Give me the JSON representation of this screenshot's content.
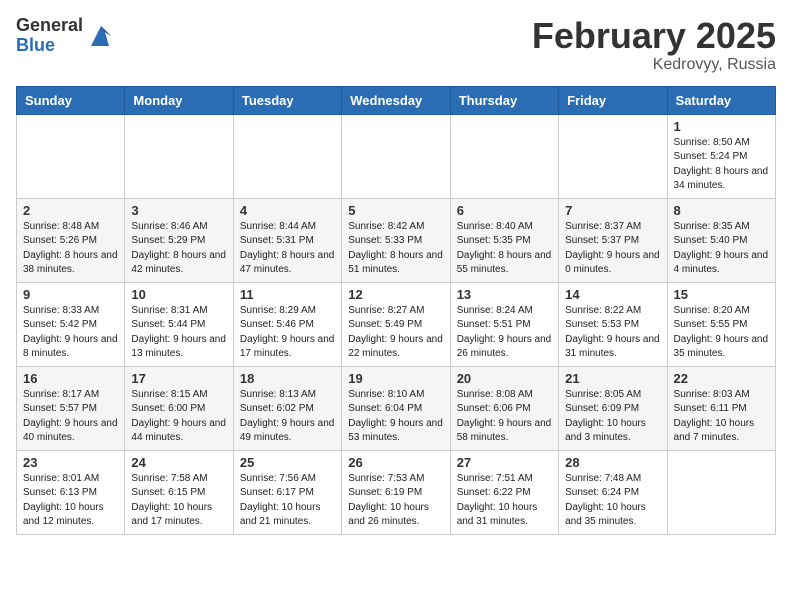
{
  "header": {
    "logo_general": "General",
    "logo_blue": "Blue",
    "month_year": "February 2025",
    "location": "Kedrovyy, Russia"
  },
  "weekdays": [
    "Sunday",
    "Monday",
    "Tuesday",
    "Wednesday",
    "Thursday",
    "Friday",
    "Saturday"
  ],
  "weeks": [
    [
      {
        "day": "",
        "info": ""
      },
      {
        "day": "",
        "info": ""
      },
      {
        "day": "",
        "info": ""
      },
      {
        "day": "",
        "info": ""
      },
      {
        "day": "",
        "info": ""
      },
      {
        "day": "",
        "info": ""
      },
      {
        "day": "1",
        "info": "Sunrise: 8:50 AM\nSunset: 5:24 PM\nDaylight: 8 hours and 34 minutes."
      }
    ],
    [
      {
        "day": "2",
        "info": "Sunrise: 8:48 AM\nSunset: 5:26 PM\nDaylight: 8 hours and 38 minutes."
      },
      {
        "day": "3",
        "info": "Sunrise: 8:46 AM\nSunset: 5:29 PM\nDaylight: 8 hours and 42 minutes."
      },
      {
        "day": "4",
        "info": "Sunrise: 8:44 AM\nSunset: 5:31 PM\nDaylight: 8 hours and 47 minutes."
      },
      {
        "day": "5",
        "info": "Sunrise: 8:42 AM\nSunset: 5:33 PM\nDaylight: 8 hours and 51 minutes."
      },
      {
        "day": "6",
        "info": "Sunrise: 8:40 AM\nSunset: 5:35 PM\nDaylight: 8 hours and 55 minutes."
      },
      {
        "day": "7",
        "info": "Sunrise: 8:37 AM\nSunset: 5:37 PM\nDaylight: 9 hours and 0 minutes."
      },
      {
        "day": "8",
        "info": "Sunrise: 8:35 AM\nSunset: 5:40 PM\nDaylight: 9 hours and 4 minutes."
      }
    ],
    [
      {
        "day": "9",
        "info": "Sunrise: 8:33 AM\nSunset: 5:42 PM\nDaylight: 9 hours and 8 minutes."
      },
      {
        "day": "10",
        "info": "Sunrise: 8:31 AM\nSunset: 5:44 PM\nDaylight: 9 hours and 13 minutes."
      },
      {
        "day": "11",
        "info": "Sunrise: 8:29 AM\nSunset: 5:46 PM\nDaylight: 9 hours and 17 minutes."
      },
      {
        "day": "12",
        "info": "Sunrise: 8:27 AM\nSunset: 5:49 PM\nDaylight: 9 hours and 22 minutes."
      },
      {
        "day": "13",
        "info": "Sunrise: 8:24 AM\nSunset: 5:51 PM\nDaylight: 9 hours and 26 minutes."
      },
      {
        "day": "14",
        "info": "Sunrise: 8:22 AM\nSunset: 5:53 PM\nDaylight: 9 hours and 31 minutes."
      },
      {
        "day": "15",
        "info": "Sunrise: 8:20 AM\nSunset: 5:55 PM\nDaylight: 9 hours and 35 minutes."
      }
    ],
    [
      {
        "day": "16",
        "info": "Sunrise: 8:17 AM\nSunset: 5:57 PM\nDaylight: 9 hours and 40 minutes."
      },
      {
        "day": "17",
        "info": "Sunrise: 8:15 AM\nSunset: 6:00 PM\nDaylight: 9 hours and 44 minutes."
      },
      {
        "day": "18",
        "info": "Sunrise: 8:13 AM\nSunset: 6:02 PM\nDaylight: 9 hours and 49 minutes."
      },
      {
        "day": "19",
        "info": "Sunrise: 8:10 AM\nSunset: 6:04 PM\nDaylight: 9 hours and 53 minutes."
      },
      {
        "day": "20",
        "info": "Sunrise: 8:08 AM\nSunset: 6:06 PM\nDaylight: 9 hours and 58 minutes."
      },
      {
        "day": "21",
        "info": "Sunrise: 8:05 AM\nSunset: 6:09 PM\nDaylight: 10 hours and 3 minutes."
      },
      {
        "day": "22",
        "info": "Sunrise: 8:03 AM\nSunset: 6:11 PM\nDaylight: 10 hours and 7 minutes."
      }
    ],
    [
      {
        "day": "23",
        "info": "Sunrise: 8:01 AM\nSunset: 6:13 PM\nDaylight: 10 hours and 12 minutes."
      },
      {
        "day": "24",
        "info": "Sunrise: 7:58 AM\nSunset: 6:15 PM\nDaylight: 10 hours and 17 minutes."
      },
      {
        "day": "25",
        "info": "Sunrise: 7:56 AM\nSunset: 6:17 PM\nDaylight: 10 hours and 21 minutes."
      },
      {
        "day": "26",
        "info": "Sunrise: 7:53 AM\nSunset: 6:19 PM\nDaylight: 10 hours and 26 minutes."
      },
      {
        "day": "27",
        "info": "Sunrise: 7:51 AM\nSunset: 6:22 PM\nDaylight: 10 hours and 31 minutes."
      },
      {
        "day": "28",
        "info": "Sunrise: 7:48 AM\nSunset: 6:24 PM\nDaylight: 10 hours and 35 minutes."
      },
      {
        "day": "",
        "info": ""
      }
    ]
  ]
}
